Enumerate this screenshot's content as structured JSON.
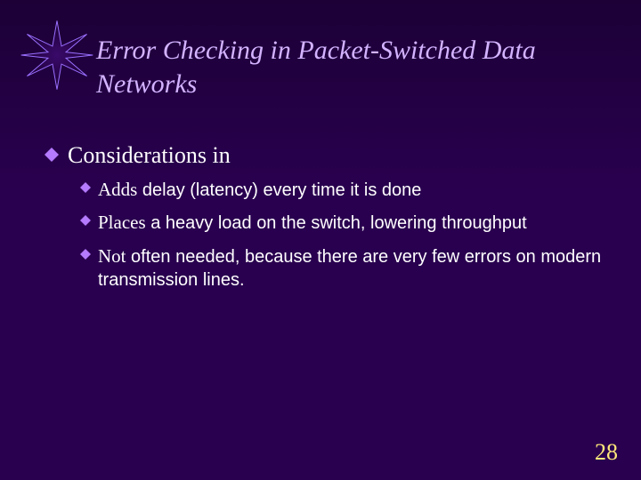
{
  "slide": {
    "title": "Error Checking in Packet-Switched Data Networks",
    "page_number": "28"
  },
  "bullets": {
    "lvl1": "Considerations in",
    "sub": [
      {
        "lead": "Adds",
        "rest": " delay (latency) every time it is done"
      },
      {
        "lead": "Places",
        "rest": " a heavy load on the switch, lowering throughput"
      },
      {
        "lead": "Not",
        "rest": " often needed, because there are very few errors on modern transmission lines."
      }
    ]
  },
  "colors": {
    "title": "#d3b3ff",
    "bullet": "#b47aff",
    "pagenum": "#ffe97a"
  }
}
